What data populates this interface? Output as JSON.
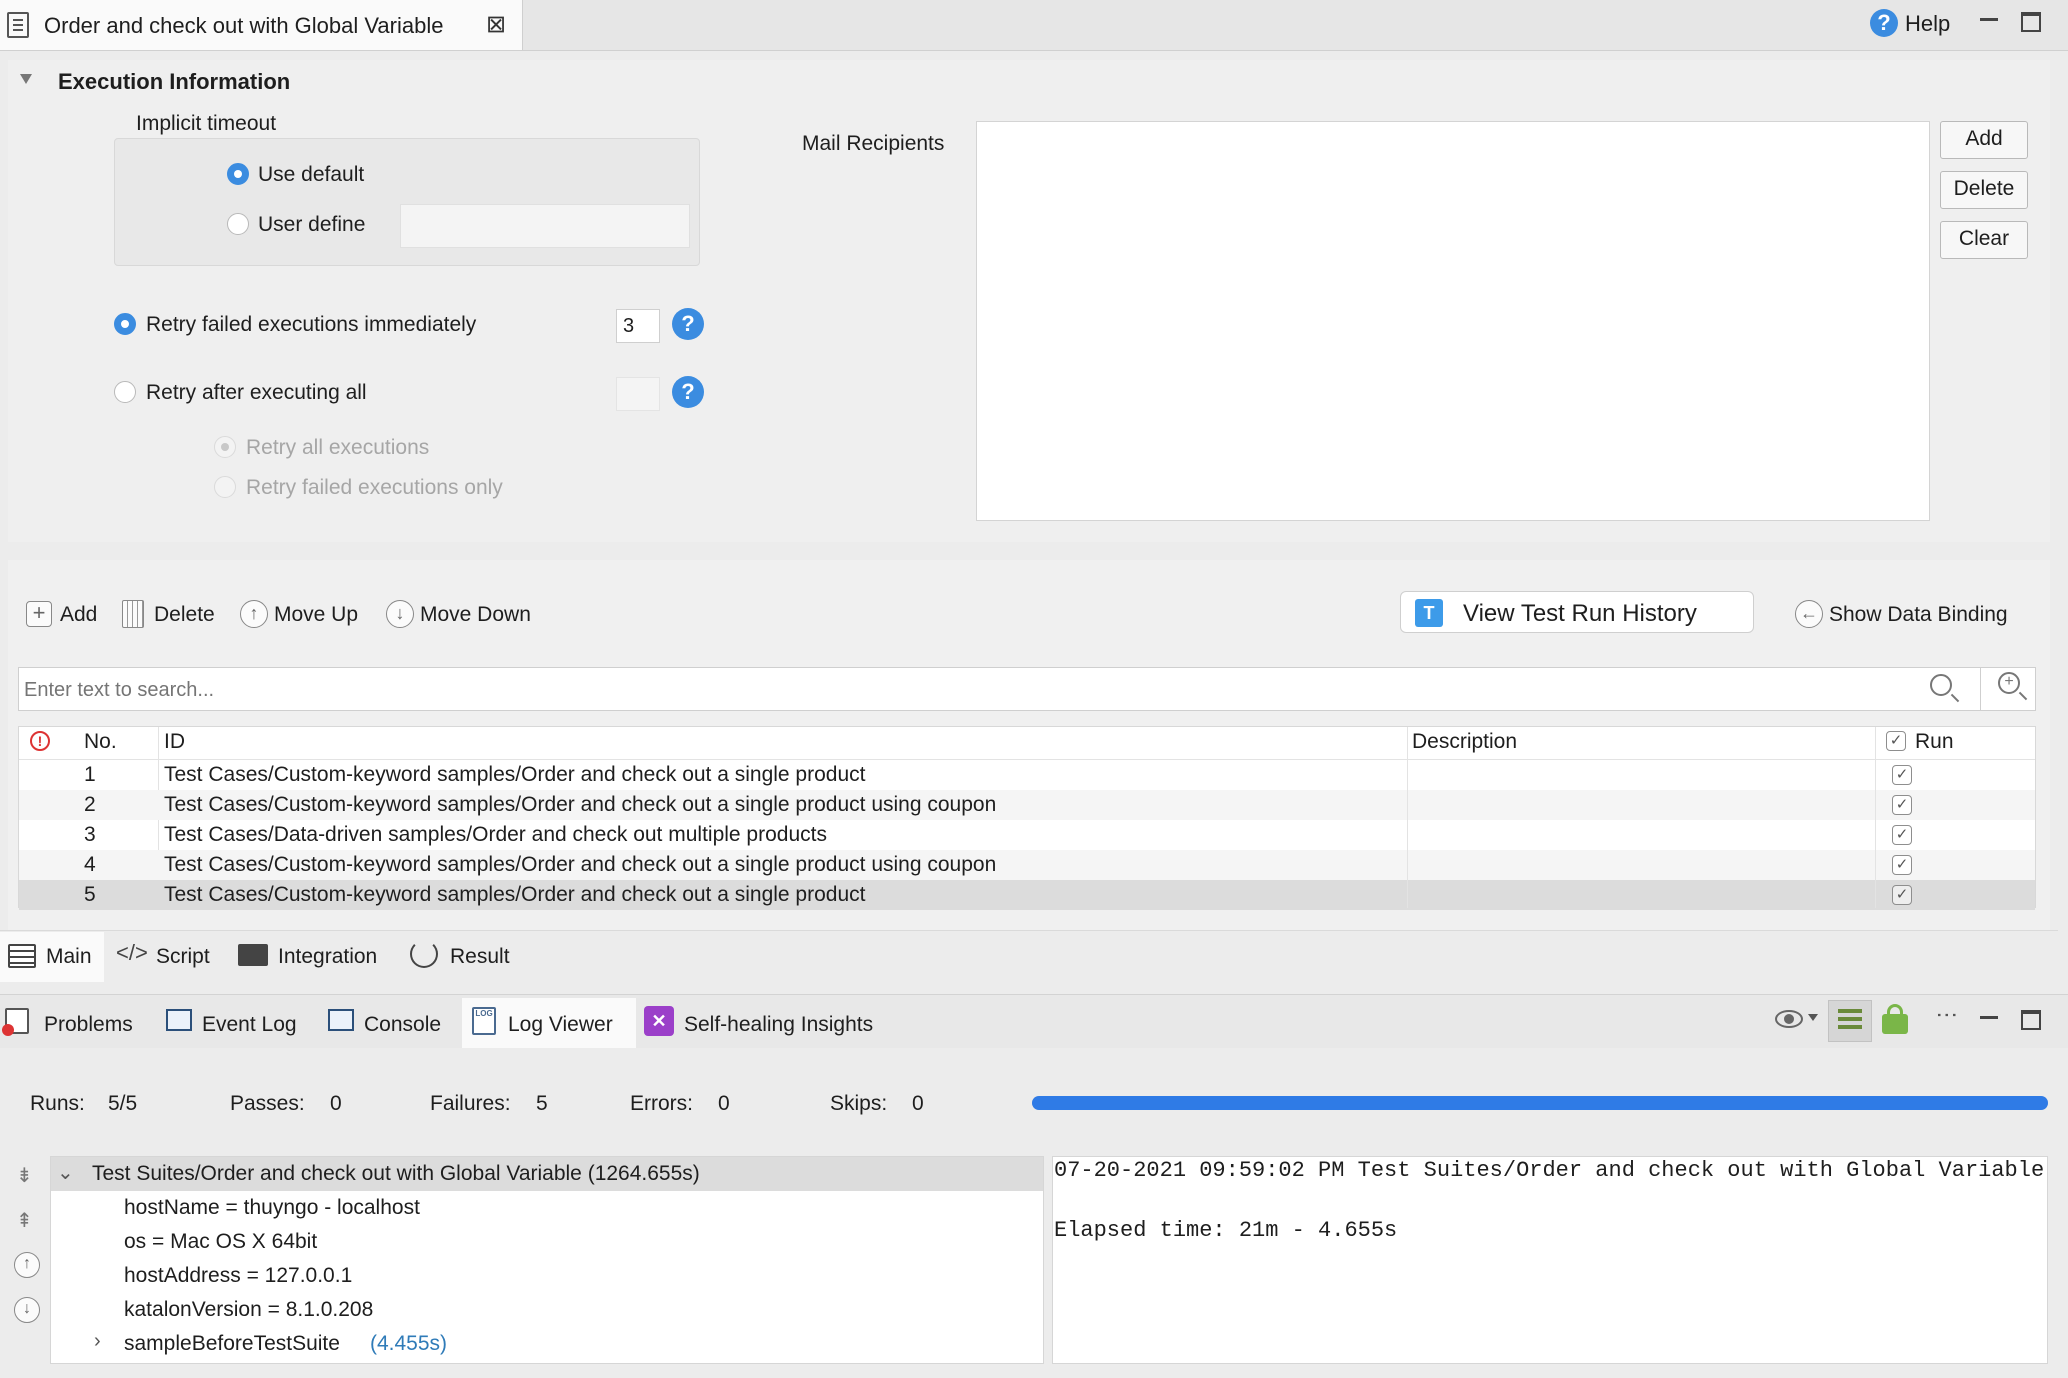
{
  "editor_tab": {
    "title": "Order and check out with Global Variable"
  },
  "window_controls": {
    "help_label": "Help"
  },
  "execution": {
    "section_title": "Execution Information",
    "implicit_timeout_label": "Implicit timeout",
    "use_default_label": "Use default",
    "user_define_label": "User define",
    "user_define_value": "",
    "retry_immediately_label": "Retry failed executions immediately",
    "retry_immediately_value": "3",
    "retry_after_label": "Retry after executing all",
    "retry_after_value": "",
    "retry_all_label": "Retry all executions",
    "retry_failed_only_label": "Retry failed executions only",
    "mail_recipients_label": "Mail Recipients",
    "mail_add_label": "Add",
    "mail_delete_label": "Delete",
    "mail_clear_label": "Clear"
  },
  "toolbar": {
    "add_label": "Add",
    "delete_label": "Delete",
    "move_up_label": "Move Up",
    "move_down_label": "Move Down",
    "view_history_label": "View Test Run History",
    "show_binding_label": "Show Data Binding"
  },
  "search": {
    "placeholder": "Enter text to search..."
  },
  "table": {
    "headers": {
      "no": "No.",
      "id": "ID",
      "description": "Description",
      "run": "Run"
    },
    "rows": [
      {
        "no": "1",
        "id": "Test Cases/Custom-keyword samples/Order and check out a single product",
        "description": "",
        "run": true
      },
      {
        "no": "2",
        "id": "Test Cases/Custom-keyword samples/Order and check out a single product using coupon",
        "description": "",
        "run": true
      },
      {
        "no": "3",
        "id": "Test Cases/Data-driven samples/Order and check out multiple products",
        "description": "",
        "run": true
      },
      {
        "no": "4",
        "id": "Test Cases/Custom-keyword samples/Order and check out a single product using coupon",
        "description": "",
        "run": true
      },
      {
        "no": "5",
        "id": "Test Cases/Custom-keyword samples/Order and check out a single product",
        "description": "",
        "run": true
      }
    ]
  },
  "editor_tabs": {
    "main": "Main",
    "script": "Script",
    "integration": "Integration",
    "result": "Result"
  },
  "bottom_tabs": {
    "problems": "Problems",
    "event_log": "Event Log",
    "console": "Console",
    "log_viewer": "Log Viewer",
    "self_healing": "Self-healing Insights"
  },
  "stats": {
    "runs_label": "Runs:",
    "runs_value": "5/5",
    "passes_label": "Passes:",
    "passes_value": "0",
    "failures_label": "Failures:",
    "failures_value": "5",
    "errors_label": "Errors:",
    "errors_value": "0",
    "skips_label": "Skips:",
    "skips_value": "0",
    "progress_fraction": 1.0
  },
  "log_tree": {
    "root": "Test Suites/Order and check out with Global Variable (1264.655s)",
    "props": [
      "hostName = thuyngo - localhost",
      "os = Mac OS X 64bit",
      "hostAddress = 127.0.0.1",
      "katalonVersion = 8.1.0.208"
    ],
    "child_name": "sampleBeforeTestSuite",
    "child_time": "(4.455s)"
  },
  "log_detail": {
    "line1": "07-20-2021 09:59:02 PM Test Suites/Order and check out with Global Variable",
    "line2": "Elapsed time: 21m - 4.655s"
  },
  "colors": {
    "accent": "#3b8ce0",
    "progress": "#2f7be6",
    "selected_row": "#dcdcdc"
  }
}
